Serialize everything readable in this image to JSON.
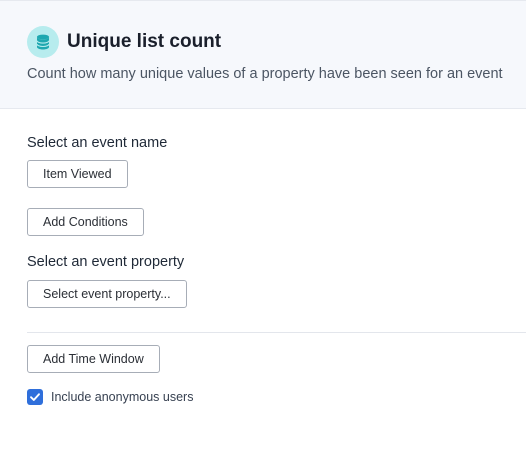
{
  "header": {
    "icon": "database-icon",
    "title": "Unique list count",
    "subtitle": "Count how many unique values of a property have been seen for an event"
  },
  "event": {
    "label": "Select an event name",
    "selected_value": "Item Viewed",
    "add_conditions_label": "Add Conditions"
  },
  "property": {
    "label": "Select an event property",
    "placeholder": "Select event property..."
  },
  "time_window": {
    "button_label": "Add Time Window"
  },
  "anonymous": {
    "label": "Include anonymous users",
    "checked": true
  },
  "colors": {
    "accent": "#2f6fdb",
    "icon_bg": "#b7ecee",
    "icon_fg": "#1fa8b0",
    "header_bg": "#f6f8fc"
  }
}
